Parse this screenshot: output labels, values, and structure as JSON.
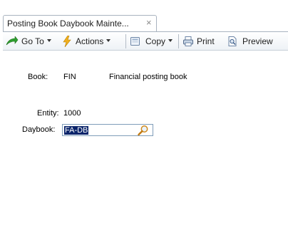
{
  "tab": {
    "title": "Posting Book Daybook Mainte...",
    "close_glyph": "×"
  },
  "toolbar": {
    "goto_label": "Go To",
    "actions_label": "Actions",
    "copy_label": "Copy",
    "print_label": "Print",
    "preview_label": "Preview"
  },
  "form": {
    "book_label": "Book:",
    "book_code": "FIN",
    "book_description": "Financial posting book",
    "entity_label": "Entity:",
    "entity_value": "1000",
    "daybook_label": "Daybook:",
    "daybook_value": "FA-DB"
  },
  "icons": {
    "goto": "green-arrow-icon",
    "actions": "lightning-icon",
    "copy": "copy-icon",
    "print": "printer-icon",
    "preview": "preview-icon",
    "lookup": "magnifier-icon"
  },
  "colors": {
    "selection_bg": "#0a246a",
    "selection_fg": "#ffffff",
    "input_border": "#7f9db9",
    "goto_green": "#2f9e2f",
    "actions_yellow": "#f2b01e"
  }
}
